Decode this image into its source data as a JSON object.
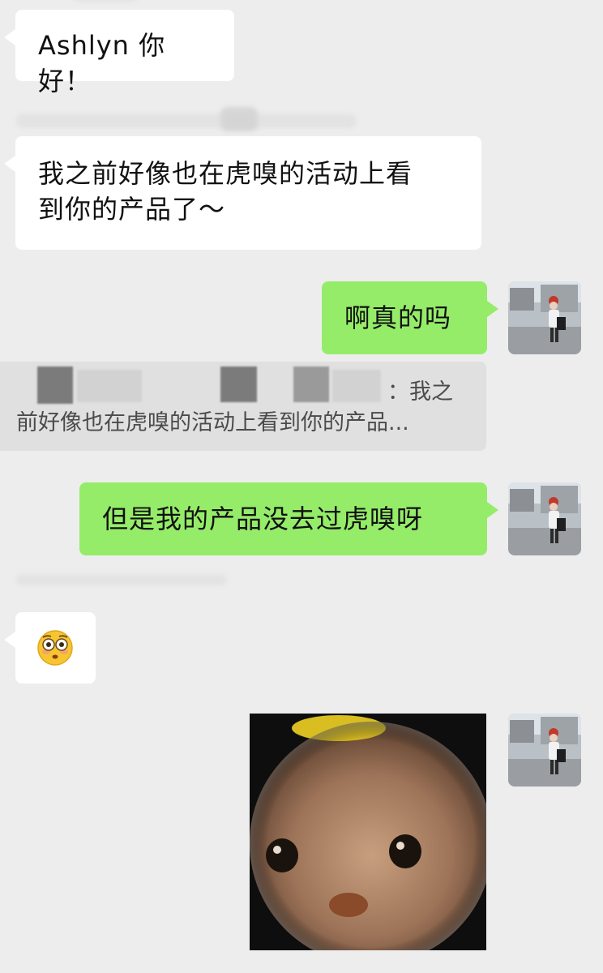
{
  "messages": {
    "greeting": "Ashlyn 你好！",
    "activity_line1": "我之前好像也在虎嗅的活动上看",
    "activity_line2": "到你的产品了～",
    "really": "啊真的吗",
    "quote_sep": "：我之",
    "quote_line2": "前好像也在虎嗅的活动上看到你的产品...",
    "not_been": "但是我的产品没去过虎嗅呀",
    "emoji": "😳"
  },
  "colors": {
    "background": "#ededed",
    "incoming_bubble": "#ffffff",
    "outgoing_bubble": "#95ec69",
    "quote_background": "#e0e0e0"
  },
  "icons": {
    "avatar": "user-avatar-photo",
    "sticker": "plush-dog-sticker"
  }
}
